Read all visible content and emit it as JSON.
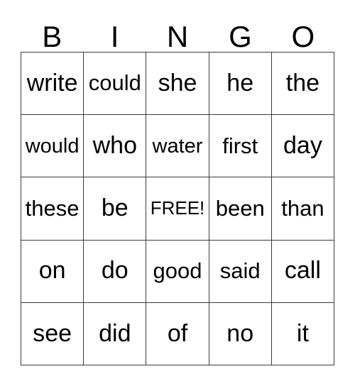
{
  "card": {
    "title_letters": [
      "B",
      "I",
      "N",
      "G",
      "O"
    ],
    "colors": {
      "grid_line": "#3c3c3c",
      "text": "#000000",
      "background": "#ffffff"
    },
    "free_space_label": "FREE!",
    "free_space_position": {
      "row": 3,
      "column": 3
    },
    "rows": [
      {
        "cells": [
          {
            "word": "write"
          },
          {
            "word": "could"
          },
          {
            "word": "she"
          },
          {
            "word": "he"
          },
          {
            "word": "the"
          }
        ]
      },
      {
        "cells": [
          {
            "word": "would"
          },
          {
            "word": "who"
          },
          {
            "word": "water"
          },
          {
            "word": "first"
          },
          {
            "word": "day"
          }
        ]
      },
      {
        "cells": [
          {
            "word": "these"
          },
          {
            "word": "be"
          },
          {
            "word": "FREE!"
          },
          {
            "word": "been"
          },
          {
            "word": "than"
          }
        ]
      },
      {
        "cells": [
          {
            "word": "on"
          },
          {
            "word": "do"
          },
          {
            "word": "good"
          },
          {
            "word": "said"
          },
          {
            "word": "call"
          }
        ]
      },
      {
        "cells": [
          {
            "word": "see"
          },
          {
            "word": "did"
          },
          {
            "word": "of"
          },
          {
            "word": "no"
          },
          {
            "word": "it"
          }
        ]
      }
    ]
  }
}
